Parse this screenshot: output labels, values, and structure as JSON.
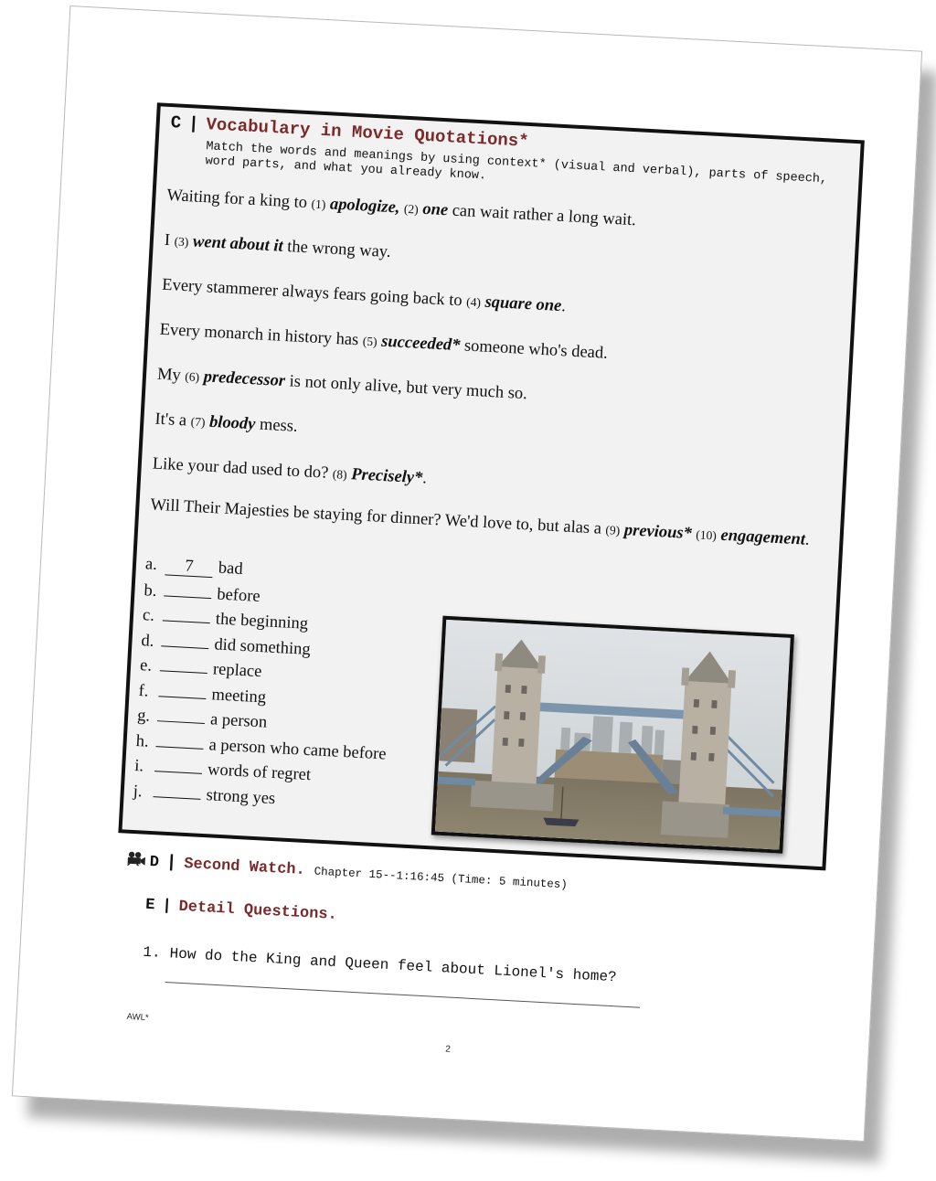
{
  "section_c": {
    "letter": "C",
    "separator": "|",
    "title": "Vocabulary in Movie Quotations*",
    "instruction": "Match the words and meanings by using context* (visual and verbal), parts of speech, word parts, and what you already know.",
    "quotes": [
      {
        "parts": [
          "Waiting for a king to ",
          "(1)",
          "apologize",
          ", ",
          "(2)",
          "one",
          " can wait rather a long wait."
        ]
      },
      {
        "parts": [
          "I ",
          "(3)",
          "went about it",
          " the wrong way."
        ]
      },
      {
        "parts": [
          "Every stammerer always fears going back to ",
          "(4)",
          "square one",
          "."
        ]
      },
      {
        "parts": [
          "Every monarch in history has ",
          "(5)",
          "succeeded*",
          " someone who's dead."
        ]
      },
      {
        "parts": [
          "My ",
          "(6)",
          "predecessor",
          " is not only alive, but very much so."
        ]
      },
      {
        "parts": [
          "It's a ",
          "(7)",
          "bloody",
          " mess."
        ]
      },
      {
        "parts": [
          "Like your dad used to do? ",
          "(8)",
          "Precisely*",
          "."
        ]
      },
      {
        "parts": [
          "Will Their Majesties be staying for dinner?   We'd love to, but alas a ",
          "(9)",
          "previous*",
          " ",
          "(10)",
          "engagement",
          "."
        ]
      }
    ],
    "matching": [
      {
        "letter": "a.",
        "answer": "7",
        "meaning": "bad"
      },
      {
        "letter": "b.",
        "answer": "",
        "meaning": "before"
      },
      {
        "letter": "c.",
        "answer": "",
        "meaning": "the beginning"
      },
      {
        "letter": "d.",
        "answer": "",
        "meaning": "did something"
      },
      {
        "letter": "e.",
        "answer": "",
        "meaning": "replace"
      },
      {
        "letter": "f.",
        "answer": "",
        "meaning": "meeting"
      },
      {
        "letter": "g.",
        "answer": "",
        "meaning": "a person"
      },
      {
        "letter": "h.",
        "answer": "",
        "meaning": "a person who came before"
      },
      {
        "letter": "i.",
        "answer": "",
        "meaning": "words of regret"
      },
      {
        "letter": "j.",
        "answer": "",
        "meaning": "strong yes"
      }
    ],
    "photo_alt": "Tower Bridge, London, with bascules raised over the Thames"
  },
  "section_d": {
    "icon": "film-camera-icon",
    "letter": "D",
    "separator": "|",
    "title": "Second Watch.",
    "chapter": "Chapter 15--1:16:45  (Time: 5 minutes)"
  },
  "section_e": {
    "letter": "E",
    "separator": "|",
    "title": "Detail Questions.",
    "questions": [
      {
        "number": "1.",
        "text": "How do the King and Queen feel about Lionel's home?"
      }
    ]
  },
  "footer": {
    "note": "AWL*",
    "page_number": "2"
  },
  "colors": {
    "title_accent": "#7a2a2a",
    "box_background": "#f2f2f2"
  }
}
